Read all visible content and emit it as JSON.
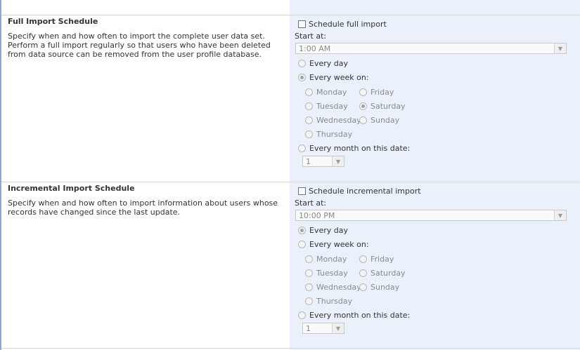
{
  "full": {
    "title": "Full Import Schedule",
    "description": "Specify when and how often to import the complete user data set. Perform a full import regularly so that users who have been deleted from data source can be removed from the user profile database.",
    "enable_label": "Schedule full import",
    "enabled": false,
    "start_at_label": "Start at:",
    "start_time": "1:00 AM",
    "frequency_options": [
      "Every day",
      "Every week on:",
      "Every month on this date:"
    ],
    "selected_frequency": "Every week on:",
    "days": [
      "Monday",
      "Friday",
      "Tuesday",
      "Saturday",
      "Wednesday",
      "Sunday",
      "Thursday"
    ],
    "selected_day": "Saturday",
    "month_date": "1"
  },
  "incremental": {
    "title": "Incremental Import Schedule",
    "description": "Specify when and how often to import information about users whose records have changed since the last update.",
    "enable_label": "Schedule incremental import",
    "enabled": false,
    "start_at_label": "Start at:",
    "start_time": "10:00 PM",
    "frequency_options": [
      "Every day",
      "Every week on:",
      "Every month on this date:"
    ],
    "selected_frequency": "Every day",
    "days": [
      "Monday",
      "Friday",
      "Tuesday",
      "Saturday",
      "Wednesday",
      "Sunday",
      "Thursday"
    ],
    "selected_day": "",
    "month_date": "1"
  },
  "icons": {
    "dropdown": "chevron-down-icon"
  },
  "colors": {
    "right_pane_bg": "#eaf1fb",
    "left_border": "#8fa8c8",
    "disabled_text": "#8a8a8a"
  }
}
